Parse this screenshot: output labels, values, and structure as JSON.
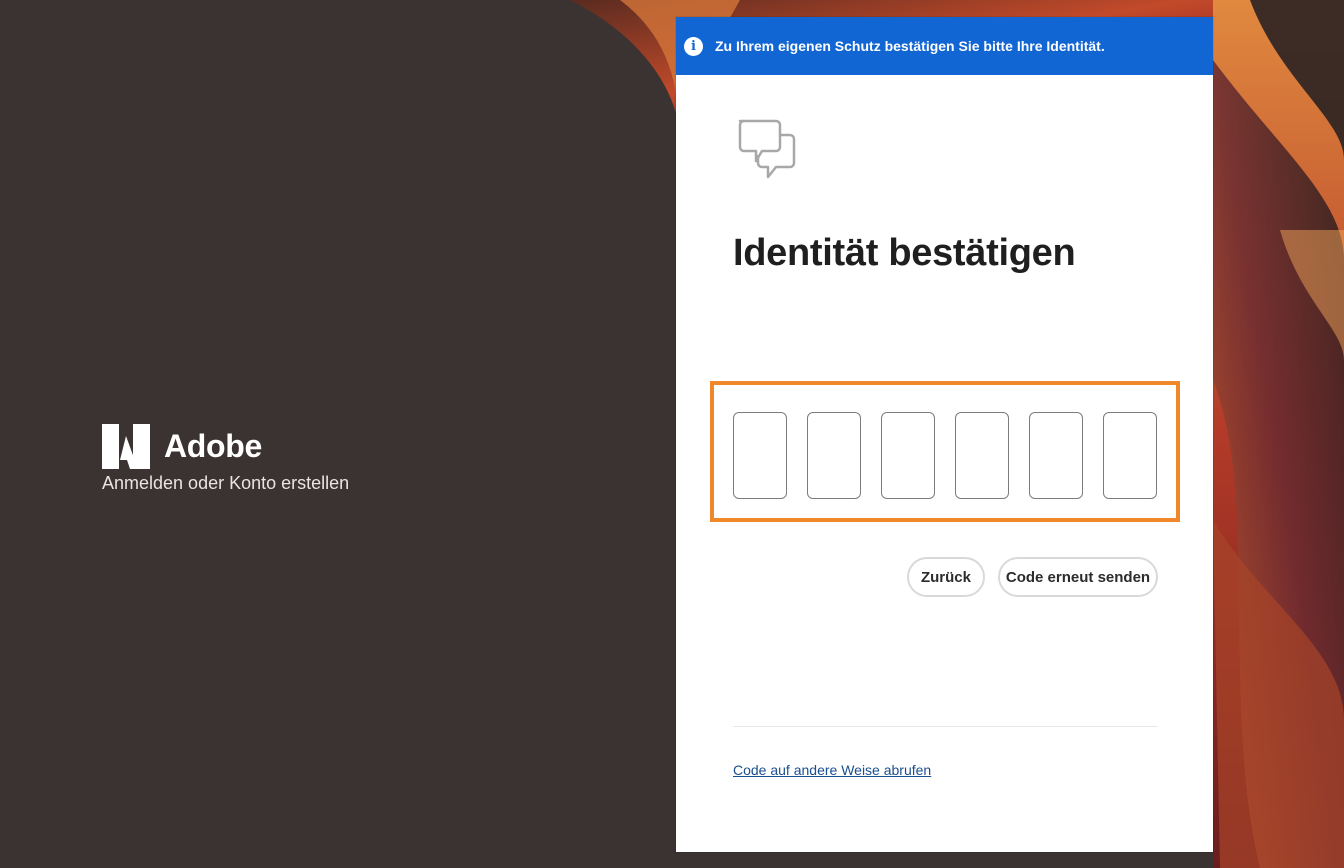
{
  "brand": {
    "name": "Adobe",
    "tagline": "Anmelden oder Konto erstellen",
    "logo_icon": "adobe-logo-icon"
  },
  "banner": {
    "icon": "info-icon",
    "icon_glyph": "i",
    "text": "Zu Ihrem eigenen Schutz bestätigen Sie bitte Ihre Identität.",
    "color": "#1266d4"
  },
  "card": {
    "header_icon": "chat-bubbles-icon",
    "title": "Identität bestätigen"
  },
  "code_input": {
    "digits": [
      "",
      "",
      "",
      "",
      "",
      ""
    ],
    "highlight_color": "#f0882b"
  },
  "buttons": {
    "back_label": "Zurück",
    "resend_label": "Code erneut senden"
  },
  "alt_link": {
    "label": "Code auf andere Weise abrufen"
  }
}
